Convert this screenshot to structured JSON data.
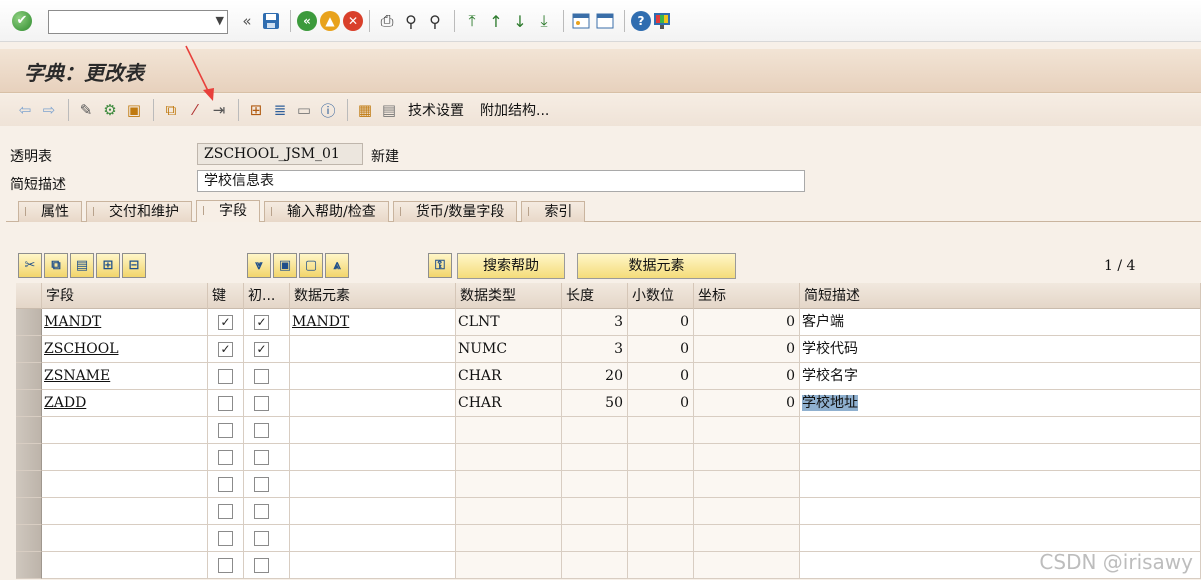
{
  "command_field": {
    "value": ""
  },
  "title": "字典：更改表",
  "toolbar": {
    "tech_settings": "技术设置",
    "append_structure": "附加结构..."
  },
  "header": {
    "table_label": "透明表",
    "table_name": "ZSCHOOL_JSM_01",
    "status": "新建",
    "desc_label": "简短描述",
    "desc_value": "学校信息表"
  },
  "tabs": [
    {
      "label": "属性"
    },
    {
      "label": "交付和维护"
    },
    {
      "label": "字段",
      "active": true
    },
    {
      "label": "输入帮助/检查"
    },
    {
      "label": "货币/数量字段"
    },
    {
      "label": "索引"
    }
  ],
  "table_toolbar": {
    "search_help": "搜索帮助",
    "data_element": "数据元素",
    "page": "1 / 4"
  },
  "columns": [
    "字段",
    "键",
    "初...",
    "数据元素",
    "数据类型",
    "长度",
    "小数位",
    "坐标",
    "简短描述"
  ],
  "rows": [
    {
      "field": "MANDT",
      "key": true,
      "init": true,
      "data_element": "MANDT",
      "type": "CLNT",
      "length": "3",
      "decimals": "0",
      "coord": "0",
      "desc": "客户端"
    },
    {
      "field": "ZSCHOOL",
      "key": true,
      "init": true,
      "data_element": "",
      "type": "NUMC",
      "length": "3",
      "decimals": "0",
      "coord": "0",
      "desc": "学校代码"
    },
    {
      "field": "ZSNAME",
      "key": false,
      "init": false,
      "data_element": "",
      "type": "CHAR",
      "length": "20",
      "decimals": "0",
      "coord": "0",
      "desc": "学校名字"
    },
    {
      "field": "ZADD",
      "key": false,
      "init": false,
      "data_element": "",
      "type": "CHAR",
      "length": "50",
      "decimals": "0",
      "coord": "0",
      "desc": "学校地址"
    },
    {
      "field": "",
      "key": false,
      "init": false,
      "data_element": "",
      "type": "",
      "length": "",
      "decimals": "",
      "coord": "",
      "desc": ""
    },
    {
      "field": "",
      "key": false,
      "init": false,
      "data_element": "",
      "type": "",
      "length": "",
      "decimals": "",
      "coord": "",
      "desc": ""
    },
    {
      "field": "",
      "key": false,
      "init": false,
      "data_element": "",
      "type": "",
      "length": "",
      "decimals": "",
      "coord": "",
      "desc": ""
    },
    {
      "field": "",
      "key": false,
      "init": false,
      "data_element": "",
      "type": "",
      "length": "",
      "decimals": "",
      "coord": "",
      "desc": ""
    },
    {
      "field": "",
      "key": false,
      "init": false,
      "data_element": "",
      "type": "",
      "length": "",
      "decimals": "",
      "coord": "",
      "desc": ""
    },
    {
      "field": "",
      "key": false,
      "init": false,
      "data_element": "",
      "type": "",
      "length": "",
      "decimals": "",
      "coord": "",
      "desc": ""
    }
  ],
  "watermark": "CSDN @irisawy"
}
